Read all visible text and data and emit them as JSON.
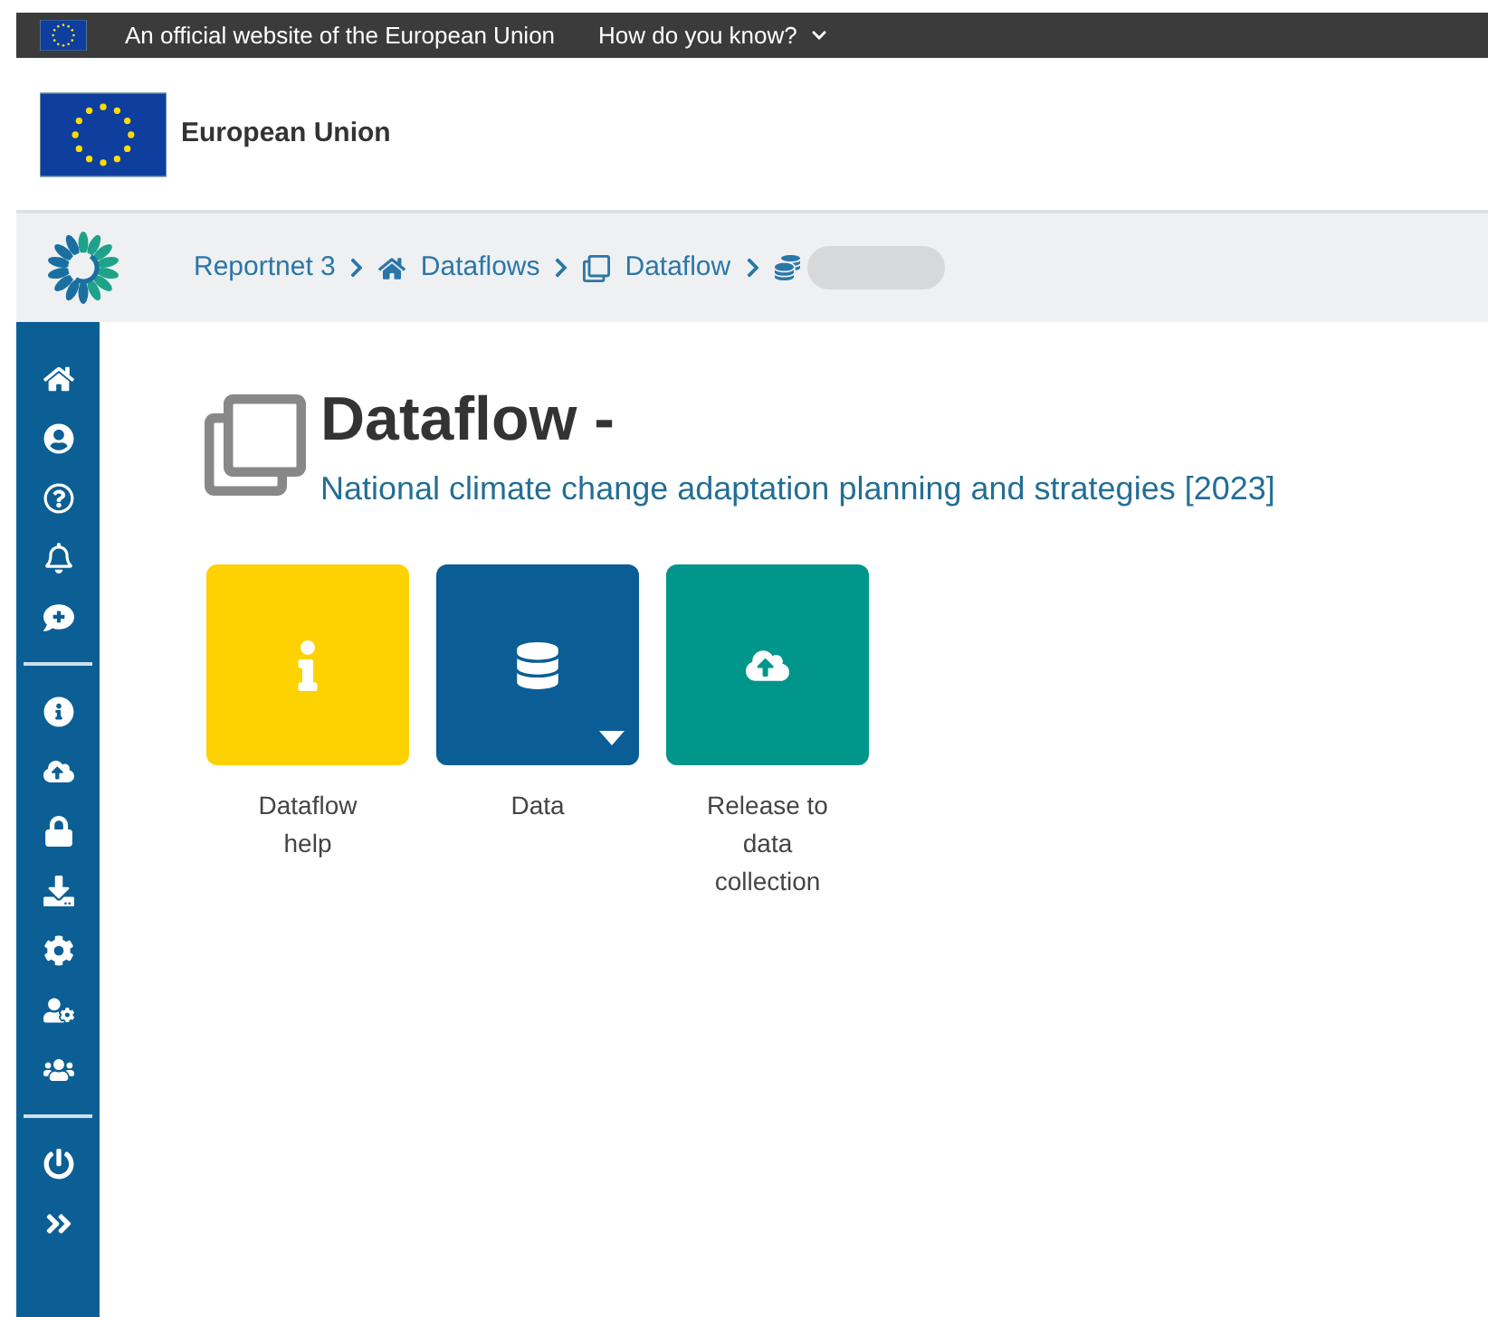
{
  "top_bar": {
    "notice": "An official website of the European Union",
    "link": "How do you know?"
  },
  "header": {
    "title": "European Union"
  },
  "breadcrumbs": [
    {
      "label": "Reportnet 3"
    },
    {
      "label": "Dataflows"
    },
    {
      "label": "Dataflow"
    }
  ],
  "page": {
    "title": "Dataflow -",
    "subtitle": "National climate change adaptation planning and strategies [2023]"
  },
  "tiles": [
    {
      "label": "Dataflow help",
      "color": "#fed100",
      "dropdown": false
    },
    {
      "label": "Data",
      "color": "#0b5d95",
      "dropdown": true
    },
    {
      "label": "Release to data collection",
      "color": "#00968c",
      "dropdown": false
    }
  ]
}
